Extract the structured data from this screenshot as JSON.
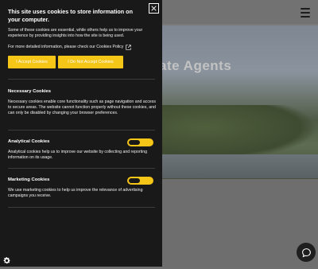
{
  "site": {
    "hero_heading": "ate Agents"
  },
  "panel": {
    "title": "This site uses cookies to store information on your computer.",
    "intro": "Some of these cookies are essential, while others help us to improve your experience by providing insights into how the site is being used.",
    "policy_text": "For more detailed information, please check our Cookies Policy",
    "accept_label": "I Accept Cookies",
    "decline_label": "I Do Not Accept Cookies",
    "sections": {
      "necessary": {
        "title": "Necessary Cookies",
        "text": "Necessary cookies enable core functionality such as page navigation and access to secure areas. The website cannot function properly without these cookies, and can only be disabled by changing your browser preferences."
      },
      "analytical": {
        "title": "Analytical Cookies",
        "text": "Analytical cookies help us to improve our website by collecting and reporting information on its usage.",
        "toggle_on": false
      },
      "marketing": {
        "title": "Marketing Cookies",
        "text": "We use marketing cookies to help us improve the relevance of advertising campaigns you receive.",
        "toggle_on": false
      }
    }
  },
  "colors": {
    "accent": "#f5c518",
    "panel_bg": "#191919"
  },
  "icons": [
    "close-icon",
    "external-link-icon",
    "menu-icon",
    "chat-icon",
    "gear-icon"
  ]
}
